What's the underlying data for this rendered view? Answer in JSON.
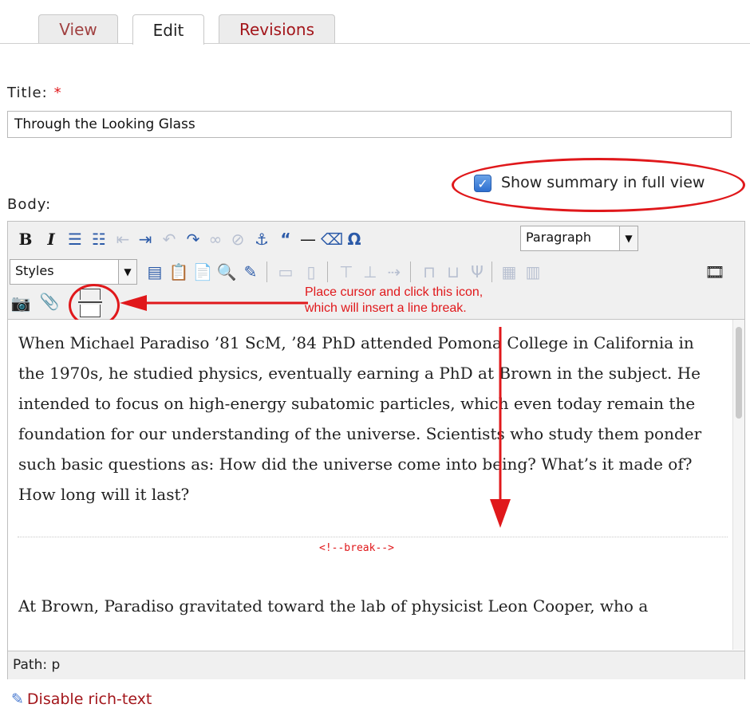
{
  "tabs": [
    {
      "label": "View"
    },
    {
      "label": "Edit"
    },
    {
      "label": "Revisions"
    }
  ],
  "title_field": {
    "label": "Title:",
    "required_marker": "*",
    "value": "Through the Looking Glass"
  },
  "summary_option": {
    "label": "Show summary in full view",
    "checked": true
  },
  "body_label": "Body:",
  "toolbar": {
    "format_select": "Paragraph",
    "styles_select": "Styles",
    "buttons_row1": [
      "bold",
      "italic",
      "bullet-list",
      "numbered-list",
      "outdent",
      "indent",
      "undo",
      "redo",
      "link",
      "unlink",
      "anchor",
      "blockquote",
      "horizontal-rule",
      "remove-format",
      "special-char"
    ],
    "buttons_row2": [
      "html-source",
      "paste-text",
      "paste-word",
      "find",
      "edit-style",
      "table-row",
      "table-col",
      "insert-row",
      "insert-col",
      "merge",
      "split",
      "table",
      "table-props",
      "media"
    ],
    "buttons_row3": [
      "image",
      "clipboard",
      "teaser-break"
    ]
  },
  "annotation": {
    "line1": "Place cursor and click this icon,",
    "line2": "which will insert a line break.",
    "color": "#e0181b"
  },
  "content": {
    "para1": "When Michael Paradiso ’81 ScM, ’84 PhD attended Pomona College in California in the 1970s, he studied physics, eventually earning a PhD at Brown in the subject. He intended to focus on high-energy subatomic particles, which even today remain the foundation for our understanding of the universe. Scientists who study them ponder such basic questions as: How did the universe come into being? What’s it made of? How long will it last?",
    "break_marker": "<!--break-->",
    "para2": "At Brown, Paradiso gravitated toward the lab of physicist Leon Cooper, who a"
  },
  "status_path": "Path: p",
  "disable_link": "Disable rich-text"
}
